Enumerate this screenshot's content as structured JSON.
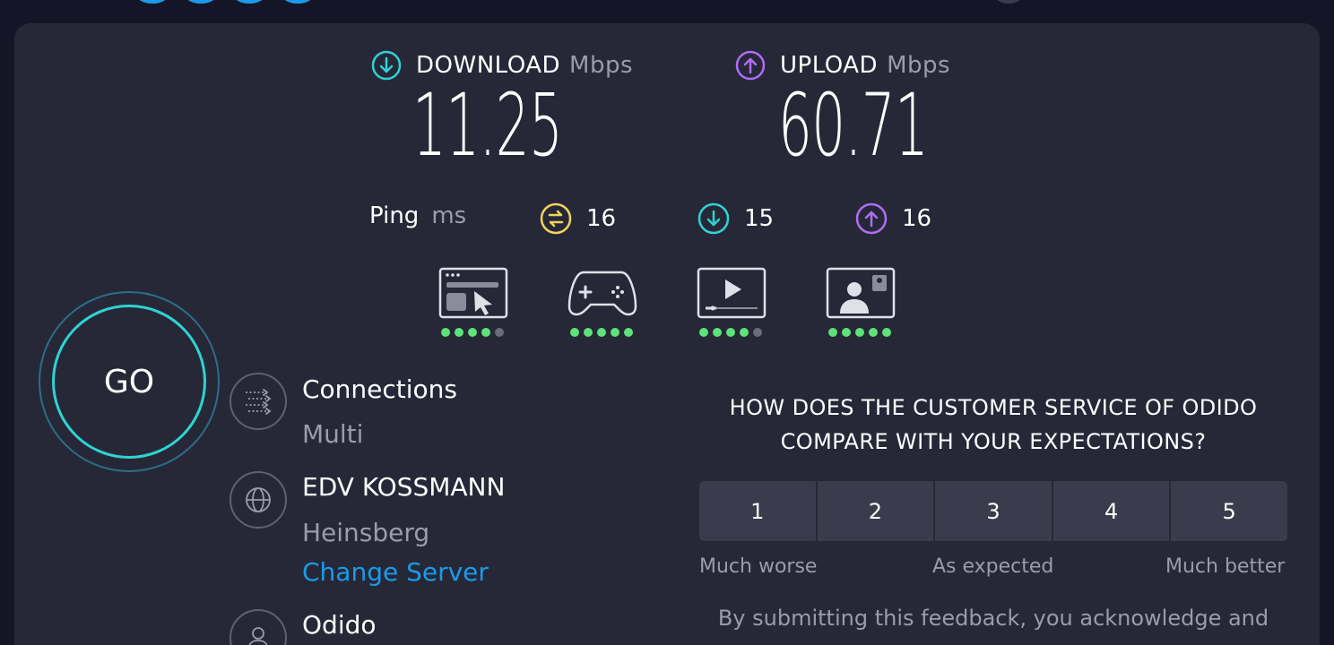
{
  "download": {
    "label": "DOWNLOAD",
    "unit": "Mbps",
    "value": "11.25"
  },
  "upload": {
    "label": "UPLOAD",
    "unit": "Mbps",
    "value": "60.71"
  },
  "ping": {
    "label": "Ping",
    "unit": "ms",
    "idle": "16",
    "download": "15",
    "upload": "16"
  },
  "quality": [
    {
      "icon": "browsing-icon",
      "rating": 4,
      "max": 5
    },
    {
      "icon": "gaming-icon",
      "rating": 5,
      "max": 5
    },
    {
      "icon": "streaming-icon",
      "rating": 4,
      "max": 5
    },
    {
      "icon": "video-call-icon",
      "rating": 5,
      "max": 5
    }
  ],
  "go_label": "GO",
  "connections": {
    "title": "Connections",
    "value": "Multi"
  },
  "server": {
    "name": "EDV KOSSMANN",
    "location": "Heinsberg",
    "change_label": "Change Server"
  },
  "provider": {
    "name": "Odido"
  },
  "survey": {
    "question_line1": "HOW DOES THE CUSTOMER SERVICE OF ODIDO",
    "question_line2": "COMPARE WITH YOUR EXPECTATIONS?",
    "options": [
      "1",
      "2",
      "3",
      "4",
      "5"
    ],
    "low_label": "Much worse",
    "mid_label": "As expected",
    "high_label": "Much better",
    "disclaimer": "By submitting this feedback, you acknowledge and"
  },
  "colors": {
    "download": "#2fd3d3",
    "upload": "#b06cf5",
    "ping_idle": "#f0d35a",
    "link": "#1c9ae8",
    "good": "#5ee37a"
  }
}
